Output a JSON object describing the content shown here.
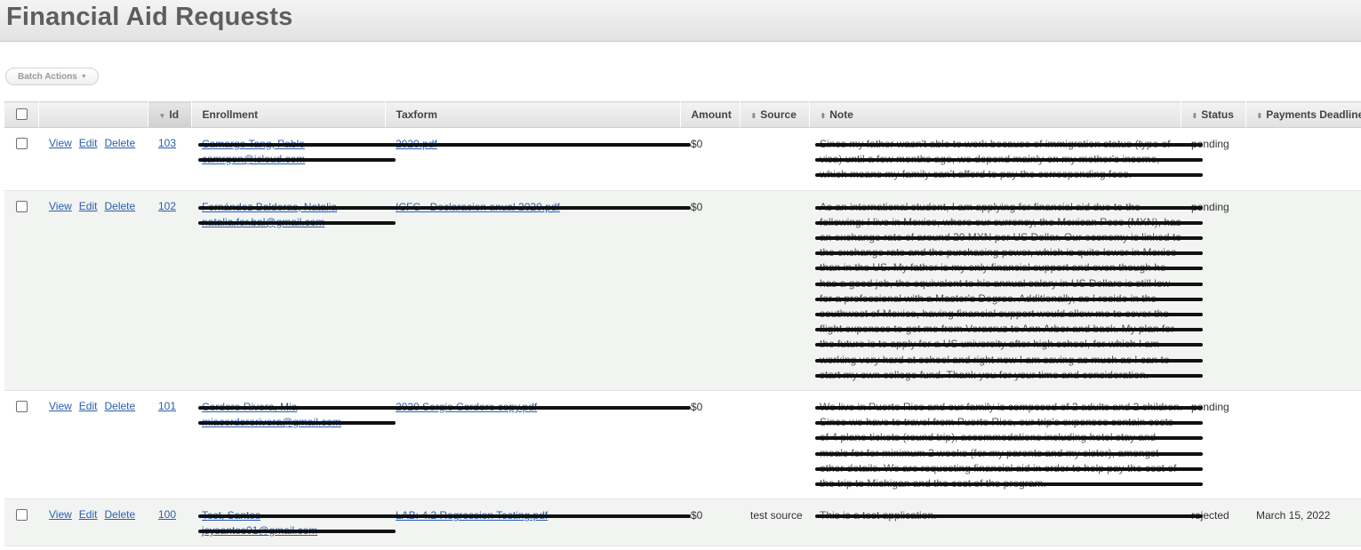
{
  "page": {
    "title": "Financial Aid Requests"
  },
  "toolbar": {
    "batch_actions_label": "Batch Actions"
  },
  "table": {
    "columns": {
      "id": "Id",
      "enrollment": "Enrollment",
      "taxform": "Taxform",
      "amount": "Amount",
      "source": "Source",
      "note": "Note",
      "status": "Status",
      "payments_deadline": "Payments Deadline"
    },
    "actions": {
      "view": "View",
      "edit": "Edit",
      "delete": "Delete"
    },
    "rows": [
      {
        "id": "103",
        "enrollment": [
          "Camargo Tang, Pablo",
          "camrgon@icloud.com"
        ],
        "taxform": "2020.pdf",
        "amount": "$0",
        "source": "",
        "note": [
          "Since my father wasn't able to work because of immigration status (type of",
          "visa) until a few months ago, we depend mainly on my mother's income,",
          "which means my family can't afford to pay the corresponding fees."
        ],
        "status": "pending",
        "payments_deadline": ""
      },
      {
        "id": "102",
        "enrollment": [
          "Fernández Balderas, Natalia",
          "natalia.fer.bal@gmail.com"
        ],
        "taxform": "ICFC - Declaracion anual 2020.pdf",
        "amount": "$0",
        "source": "",
        "note": [
          "As an international student, I am applying for financial aid due to the",
          "following: I live in Mexico, where our currency, the Mexican Peso (MXN), has",
          "an exchange rate of around 20 MXN per US Dollar. Our economy is linked to",
          "the exchange rate and the purchasing power, which is quite lower in Mexico",
          "than in the US. My father is my only financial support and even though he",
          "has a good job, the equivalent to his annual salary in US Dollars is still low",
          "for a professional with a Master's Degree. Additionally, as I reside in the",
          "southwest of Mexico, having financial support would allow me to cover the",
          "flight expenses to get me from Veracruz to Ann Arbor and back. My plan for",
          "the future is to apply for a US university after high school, for which I am",
          "working very hard at school and right now I am saving as much as I can to",
          "start my own college fund. Thank you for your time and consideration."
        ],
        "status": "pending",
        "payments_deadline": ""
      },
      {
        "id": "101",
        "enrollment": [
          "Cordero Rivera, Mia",
          "miacorderorivera@gmail.com"
        ],
        "taxform": "2020 Sergio Cordero copy.pdf",
        "amount": "$0",
        "source": "",
        "note": [
          "We live in Puerto Rico and our family is composed of 2 adults and 2 children.",
          "Since we have to travel from Puerto Rico, our trip's expenses contain costs",
          "of 4 plane tickets (round trip), accommodations including hotel stay and",
          "meals for for minimum 2 weeks (for my parents and my sister), amongst",
          "other details. We are requesting financial aid in order to help pay the cost of",
          "the trip to Michigan and the cost of the program."
        ],
        "status": "pending",
        "payments_deadline": ""
      },
      {
        "id": "100",
        "enrollment": [
          "Test, Santos",
          "jsysantos01@gmail.com"
        ],
        "taxform": "LAB: 4.2 Regression Testing.pdf",
        "amount": "$0",
        "source": "test source",
        "note": [
          "This is a test application."
        ],
        "status": "rejected",
        "payments_deadline": "March 15, 2022"
      }
    ]
  }
}
